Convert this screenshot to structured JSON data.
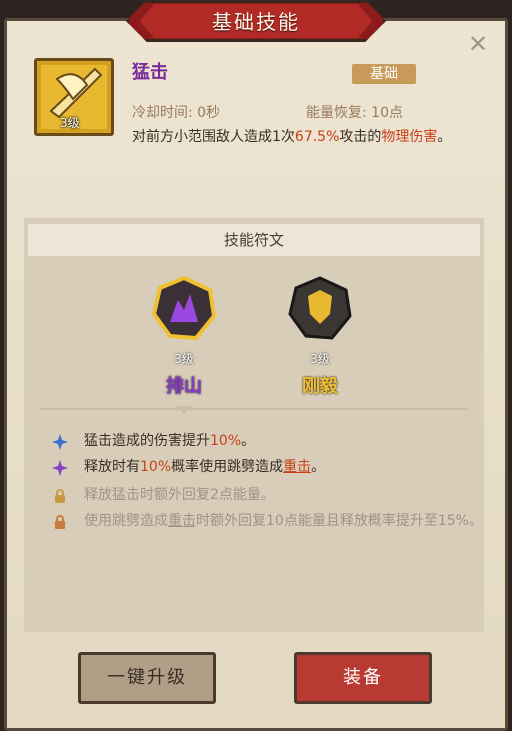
{
  "header": {
    "title": "基础技能"
  },
  "skill": {
    "name": "猛击",
    "tag": "基础",
    "level": "3级",
    "cooldown": "冷却时间: 0秒",
    "energy": "能量恢复: 10点",
    "description_prefix": "对前方小范围敌人造成1次",
    "description_percent": "67.5%",
    "description_mid": "攻击的",
    "description_type": "物理伤害",
    "description_end": "。"
  },
  "runes": {
    "header": "技能符文",
    "items": [
      {
        "level": "3级",
        "name": "排山",
        "color": "#8a3cc8"
      },
      {
        "level": "3级",
        "name": "刚毅",
        "color": "#f0c030"
      }
    ]
  },
  "effects": [
    {
      "text_a": "猛击造成的伤害提升",
      "text_b": "10%",
      "text_c": "。",
      "icon": "blue-star-icon"
    },
    {
      "text_a": "释放时有",
      "text_b": "10%",
      "text_c": "概率使用跳劈造成",
      "text_d": "重击",
      "text_e": "。",
      "icon": "purple-star-icon"
    },
    {
      "text": "释放猛击时额外回复2点能量。",
      "icon": "lock-icon"
    },
    {
      "text_a": "使用跳劈造成",
      "text_b": "重击",
      "text_c": "时额外回复10点能量且释放概率提升至15%。",
      "icon": "lock-icon"
    }
  ],
  "buttons": {
    "upgrade": "一键升级",
    "equip": "装备"
  }
}
